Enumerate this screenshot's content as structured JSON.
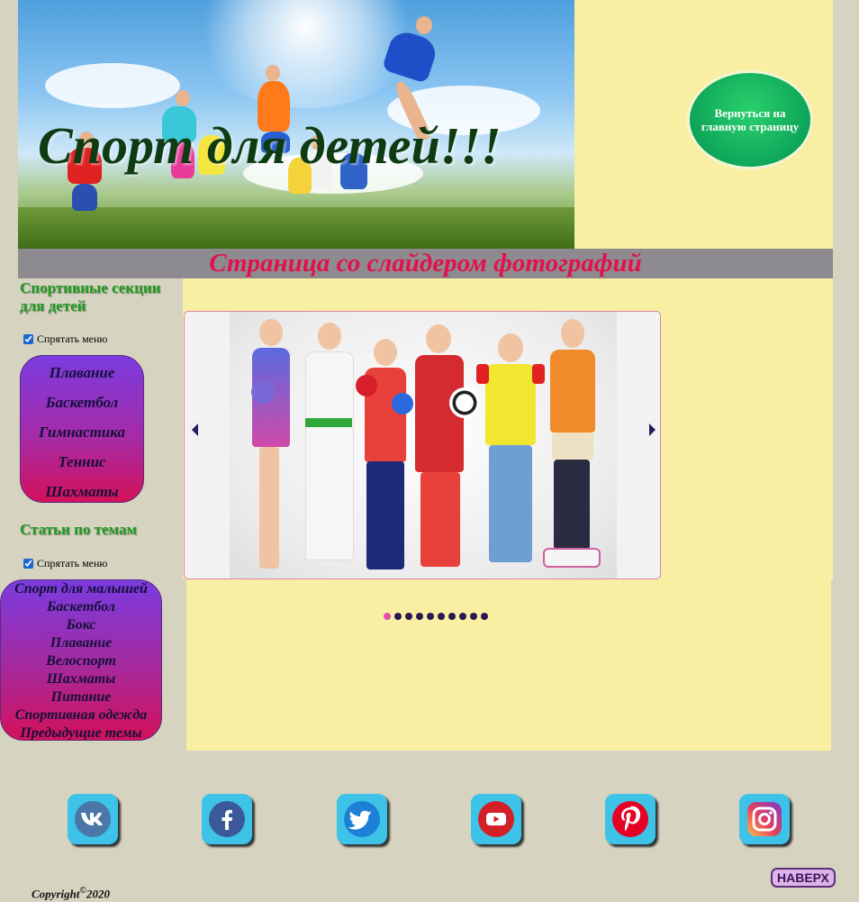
{
  "header": {
    "title": "Спорт для детей!!!",
    "back_button": "Вернуться на главную страницу",
    "subtitle": "Страница со слайдером фотографий"
  },
  "sidebar": {
    "sections_title": "Спортивные секции для детей",
    "hide_menu_label": "Спрятать меню",
    "sports": [
      "Плавание",
      "Баскетбол",
      "Гимнастика",
      "Теннис",
      "Шахматы"
    ],
    "articles_title": "Статьи по темам",
    "hide_articles_label": "Спрятать меню",
    "articles": [
      "Спорт для малышей",
      "Баскетбол",
      "Бокс",
      "Плавание",
      "Велоспорт",
      "Шахматы",
      "Питание",
      "Спортивная одежда",
      "Предыдущие темы"
    ]
  },
  "slider": {
    "total_slides": 10,
    "active_slide": 1
  },
  "social": [
    "vk-icon",
    "facebook-icon",
    "twitter-icon",
    "youtube-icon",
    "pinterest-icon",
    "instagram-icon"
  ],
  "footer": {
    "top_button": "НАВЕРХ",
    "copyright_prefix": "Copyright",
    "copyright_symbol": "©",
    "copyright_year": "2020"
  },
  "colors": {
    "background": "#d6d3c0",
    "panel": "#f8efa3",
    "subtitle": "#e3104d",
    "section_title": "#1f9b1f",
    "menu_gradient_top": "#7a3be0",
    "menu_gradient_bottom": "#d4115a"
  }
}
